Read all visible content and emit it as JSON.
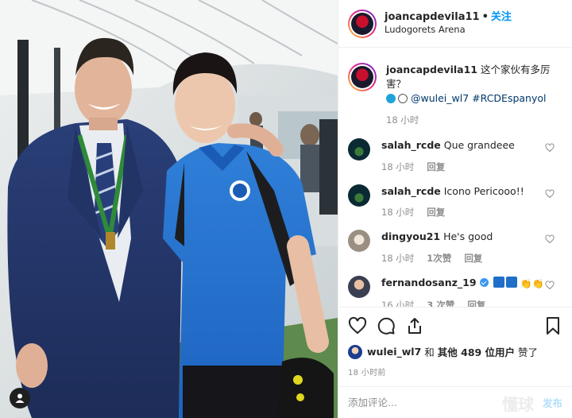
{
  "post": {
    "username": "joancapdevila11",
    "separator": "•",
    "follow_label": "关注",
    "location": "Ludogorets Arena",
    "caption": {
      "username": "joancapdevila11",
      "text": "这个家伙有多厉害？",
      "mention": "@wulei_wl7",
      "hashtag": "#RCDEspanyol",
      "time": "18 小时"
    }
  },
  "comments": [
    {
      "username": "salah_rcde",
      "text": "Que grandeee",
      "time": "18 小时",
      "likes": "",
      "reply": "回复",
      "avatar_color": "#0b2a33"
    },
    {
      "username": "salah_rcde",
      "text": "Icono Pericooo!!",
      "time": "18 小时",
      "likes": "",
      "reply": "回复",
      "avatar_color": "#0b2a33"
    },
    {
      "username": "dingyou21",
      "text": "He's good",
      "time": "18 小时",
      "likes": "1次赞",
      "reply": "回复",
      "avatar_color": "#9a8f82"
    },
    {
      "username": "fernandosanz_19",
      "text": "",
      "time": "16 小时",
      "likes": "3 次赞",
      "reply": "回复",
      "avatar_color": "#3a3f52"
    }
  ],
  "likes_line": {
    "user": "wulei_wl7",
    "and": "和",
    "others": "其他 489 位用户",
    "suffix": "赞了"
  },
  "timestamp": "18 小时前",
  "comment_input": {
    "placeholder": "添加评论..."
  },
  "post_button": "发布",
  "watermark": "懂球",
  "icons": {
    "like": "heart-icon",
    "comment": "comment-icon",
    "share": "share-icon",
    "save": "bookmark-icon",
    "user_tag": "person-icon"
  },
  "colors": {
    "link_blue": "#0095f6",
    "hashtag": "#00376b",
    "muted": "#8e8e8e",
    "border": "#efefef"
  }
}
